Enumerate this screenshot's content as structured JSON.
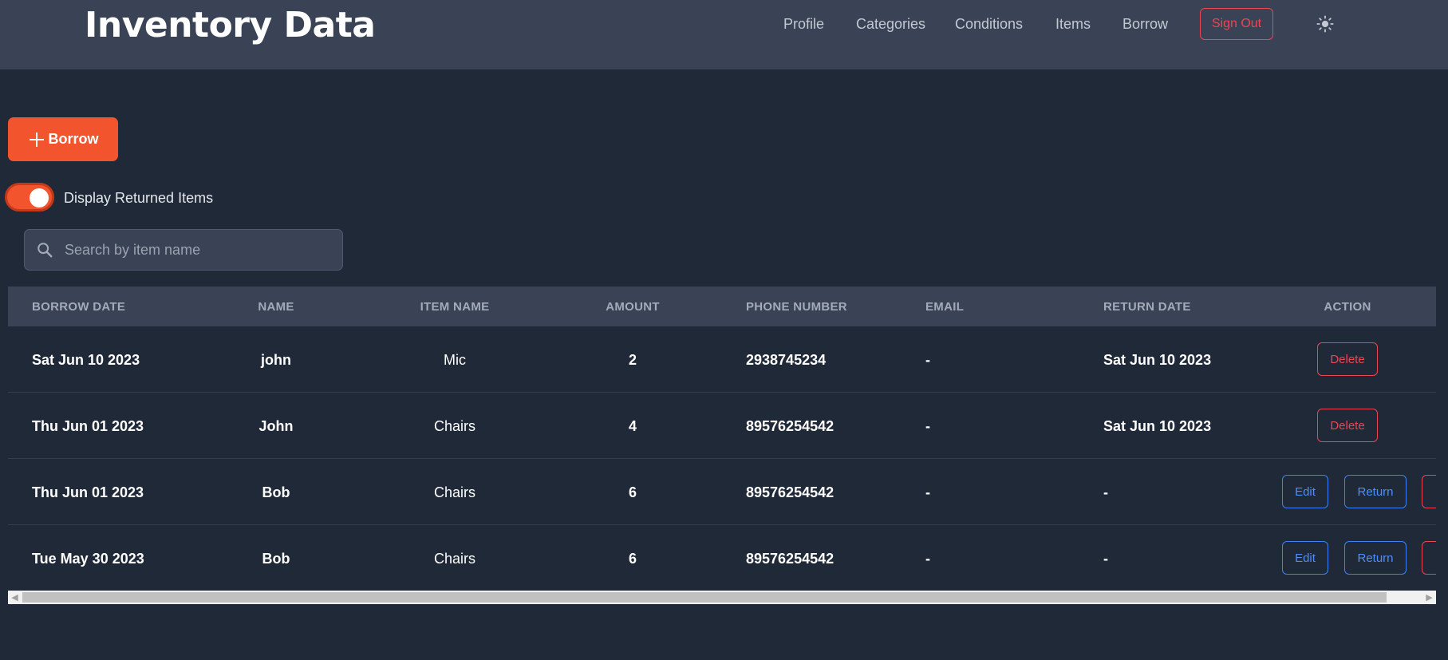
{
  "header": {
    "title": "Inventory Data",
    "nav": [
      "Profile",
      "Categories",
      "Conditions",
      "Items",
      "Borrow"
    ],
    "sign_out": "Sign Out",
    "theme_icon": "sun-icon"
  },
  "actions": {
    "borrow_label": "Borrow",
    "toggle_label": "Display Returned Items",
    "toggle_on": true
  },
  "search": {
    "placeholder": "Search by item name",
    "value": ""
  },
  "table": {
    "columns": [
      "BORROW DATE",
      "NAME",
      "ITEM NAME",
      "AMOUNT",
      "PHONE NUMBER",
      "EMAIL",
      "RETURN DATE",
      "ACTION"
    ],
    "rows": [
      {
        "borrow_date": "Sat Jun 10 2023",
        "name": "john",
        "item_name": "Mic",
        "amount": "2",
        "phone": "2938745234",
        "email": "-",
        "return_date": "Sat Jun 10 2023"
      },
      {
        "borrow_date": "Thu Jun 01 2023",
        "name": "John",
        "item_name": "Chairs",
        "amount": "4",
        "phone": "89576254542",
        "email": "-",
        "return_date": "Sat Jun 10 2023"
      },
      {
        "borrow_date": "Thu Jun 01 2023",
        "name": "Bob",
        "item_name": "Chairs",
        "amount": "6",
        "phone": "89576254542",
        "email": "-",
        "return_date": "-"
      },
      {
        "borrow_date": "Tue May 30 2023",
        "name": "Bob",
        "item_name": "Chairs",
        "amount": "6",
        "phone": "89576254542",
        "email": "-",
        "return_date": "-"
      }
    ],
    "action_labels": {
      "delete": "Delete",
      "edit": "Edit",
      "return": "Return"
    }
  },
  "colors": {
    "background": "#202938",
    "navbar": "#394355",
    "accent": "#f2542d",
    "danger": "#ef4452",
    "primary": "#3b82f6"
  }
}
